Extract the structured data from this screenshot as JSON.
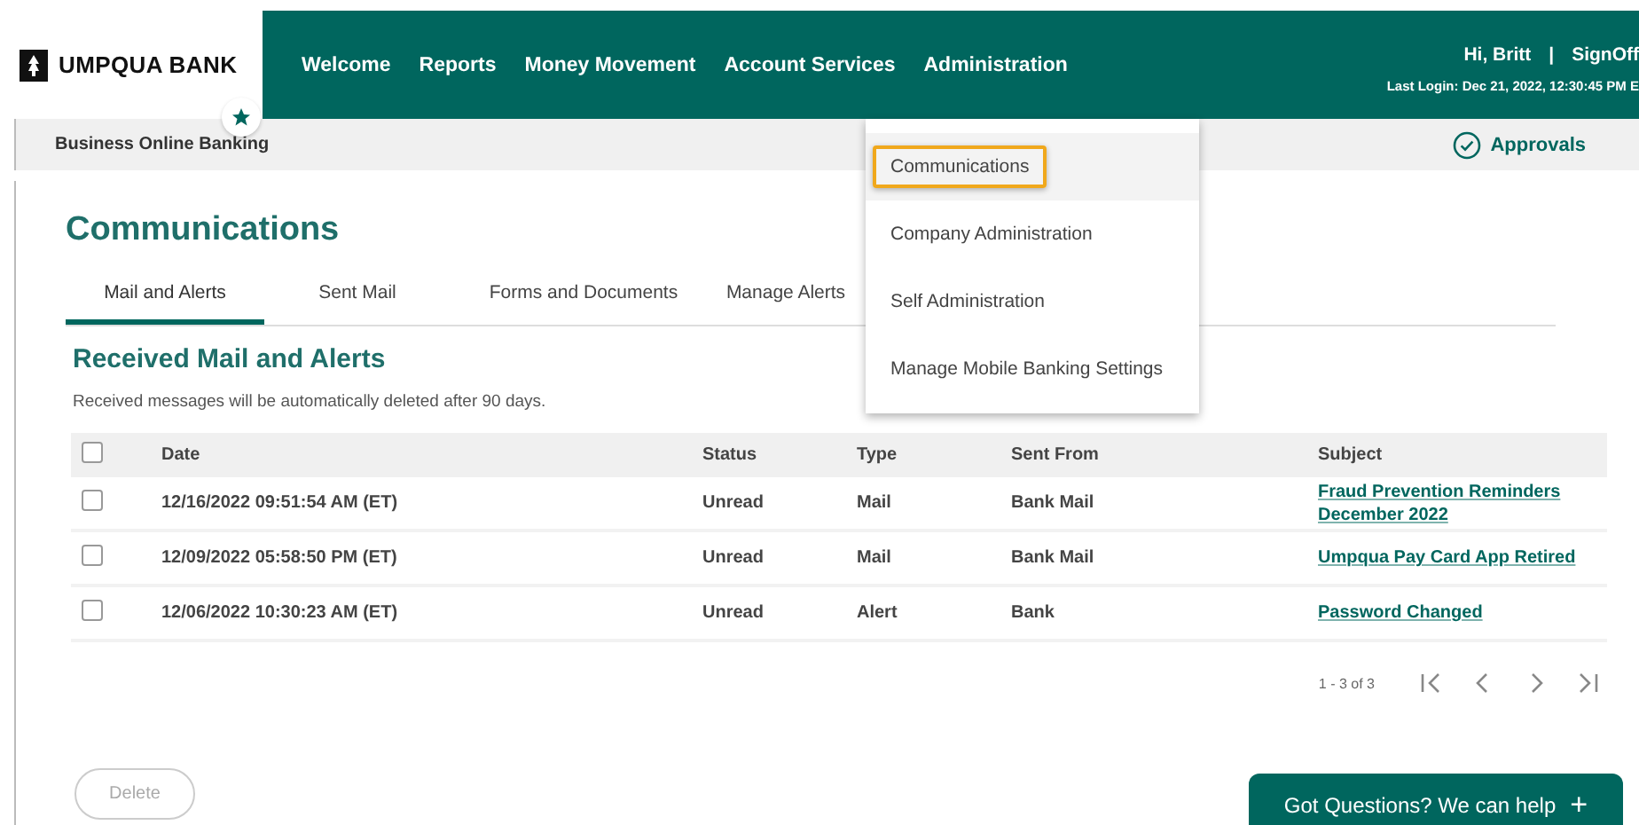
{
  "header": {
    "logo": "UMPQUA BANK",
    "nav": [
      "Welcome",
      "Reports",
      "Money Movement",
      "Account Services",
      "Administration"
    ],
    "greeting": "Hi, Britt",
    "separator": "|",
    "signoff": "SignOff",
    "last_login": "Last Login: Dec 21, 2022, 12:30:45 PM E"
  },
  "subbar": {
    "title": "Business Online Banking",
    "approvals": "Approvals"
  },
  "admin_menu": [
    {
      "label": "Communications",
      "selected": true
    },
    {
      "label": "Company Administration",
      "selected": false
    },
    {
      "label": "Self Administration",
      "selected": false
    },
    {
      "label": "Manage Mobile Banking Settings",
      "selected": false
    }
  ],
  "page_title": "Communications",
  "tabs": [
    {
      "label": "Mail and Alerts",
      "selected": true
    },
    {
      "label": "Sent Mail",
      "selected": false
    },
    {
      "label": "Forms and Documents",
      "selected": false
    },
    {
      "label": "Manage Alerts",
      "selected": false
    }
  ],
  "section_title": "Received Mail and Alerts",
  "note": "Received messages will be automatically deleted after 90 days.",
  "table": {
    "select_all_checked": false,
    "columns": [
      "Date",
      "Status",
      "Type",
      "Sent From",
      "Subject"
    ],
    "rows": [
      {
        "checked": false,
        "date": "12/16/2022 09:51:54 AM (ET)",
        "status": "Unread",
        "type": "Mail",
        "sent_from": "Bank Mail",
        "subject": "Fraud Prevention Reminders December 2022"
      },
      {
        "checked": false,
        "date": "12/09/2022 05:58:50 PM (ET)",
        "status": "Unread",
        "type": "Mail",
        "sent_from": "Bank Mail",
        "subject": "Umpqua Pay Card App Retired"
      },
      {
        "checked": false,
        "date": "12/06/2022 10:30:23 AM (ET)",
        "status": "Unread",
        "type": "Alert",
        "sent_from": "Bank",
        "subject": "Password Changed"
      }
    ]
  },
  "pagination": {
    "range": "1 - 3 of 3"
  },
  "delete_button": {
    "label": "Delete",
    "disabled": true
  },
  "help_button": {
    "label": "Got Questions? We can help",
    "icon": "+"
  }
}
